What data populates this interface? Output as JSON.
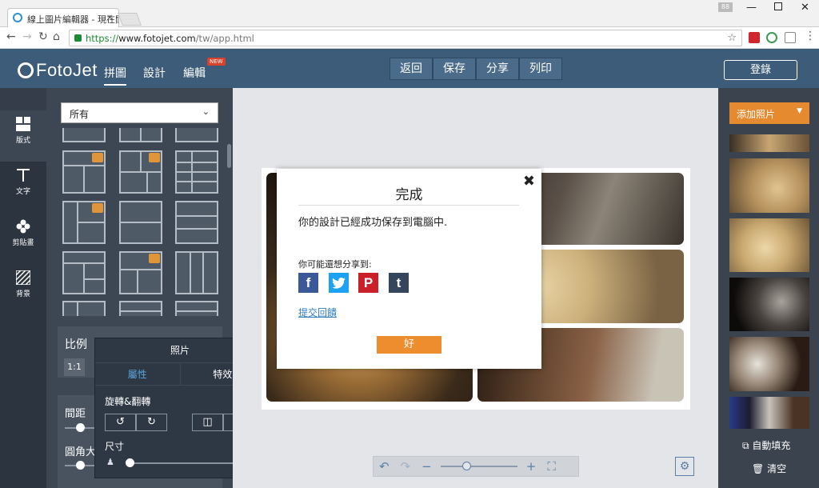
{
  "browser": {
    "tab_title": "線上圖片編輯器 - 現在開",
    "tab_close": "×",
    "badge": "88",
    "url_scheme": "https://",
    "url_host": "www.fotojet.com",
    "url_path": "/tw/app.html"
  },
  "header": {
    "logo": "FotoJet",
    "nav": [
      "拼圖",
      "設計",
      "編輯"
    ],
    "new_badge": "NEW",
    "actions": [
      "返回",
      "保存",
      "分享",
      "列印"
    ],
    "login": "登錄"
  },
  "rail": {
    "items": [
      "版式",
      "文字",
      "剪貼畫",
      "背景"
    ]
  },
  "layout_panel": {
    "category": "所有",
    "ratio_label": "比例",
    "ratio_value": "1:1",
    "spacing_label": "間距",
    "corner_label": "圓角大"
  },
  "photo_popover": {
    "title": "照片",
    "tabs": [
      "屬性",
      "特效"
    ],
    "rotate_label": "旋轉&翻轉",
    "size_label": "尺寸"
  },
  "right_panel": {
    "add_photo": "添加照片",
    "auto_fill": "自動填充",
    "clear": "清空"
  },
  "modal": {
    "title": "完成",
    "message": "你的設計已經成功保存到電腦中.",
    "share_prompt": "你可能還想分享到:",
    "social": [
      {
        "label": "f",
        "name": "facebook",
        "color": "#3b5998"
      },
      {
        "label": "t",
        "name": "twitter",
        "color": "#1da1f2"
      },
      {
        "label": "P",
        "name": "pinterest",
        "color": "#cb2027"
      },
      {
        "label": "t",
        "name": "tumblr",
        "color": "#35465c"
      }
    ],
    "feedback_link": "提交回饋",
    "ok_button": "好"
  },
  "colors": {
    "header": "#3c5c7a",
    "accent": "#ee8d2d",
    "link": "#2f7fc5"
  }
}
